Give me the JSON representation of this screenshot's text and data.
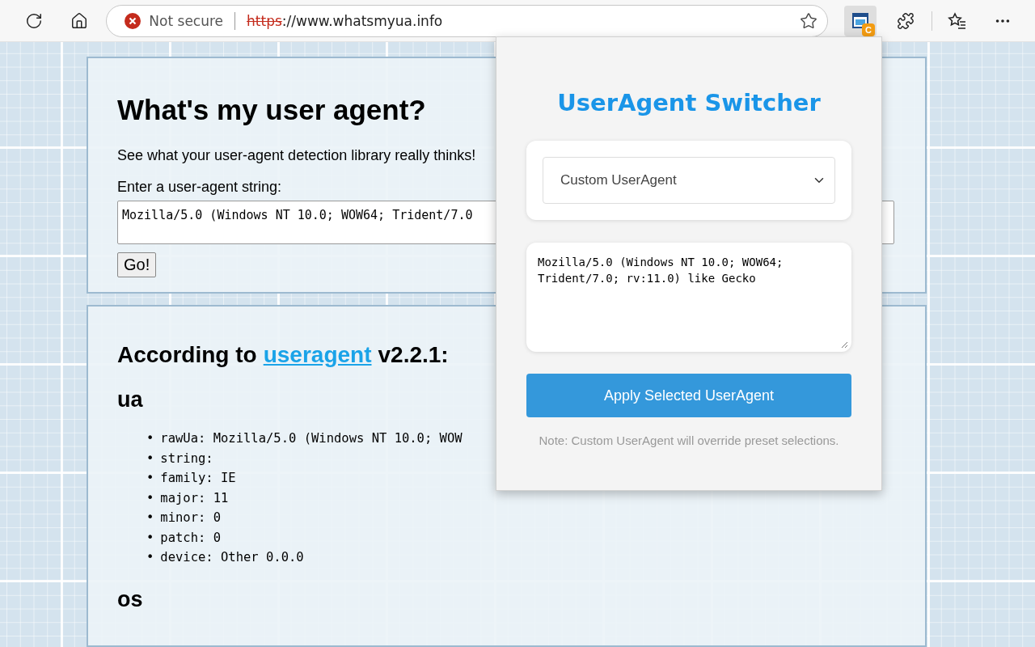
{
  "browser": {
    "security_label": "Not secure",
    "url_scheme": "https",
    "url_rest": "://www.whatsmyua.info",
    "extension_badge": "C"
  },
  "page": {
    "title": "What's my user agent?",
    "subtitle": "See what your user-agent detection library really thinks!",
    "input_label": "Enter a user-agent string:",
    "input_value": "Mozilla/5.0 (Windows NT 10.0; WOW64; Trident/7.0",
    "go_button": "Go!",
    "results_heading": {
      "prefix": "According to",
      "link": "useragent",
      "suffix": "v2.2.1:"
    },
    "sections": [
      {
        "title": "ua",
        "bullet": "•",
        "items": [
          "rawUa: Mozilla/5.0 (Windows NT 10.0; WOW",
          "string:",
          "family: IE",
          "major: 11",
          "minor: 0",
          "patch: 0",
          "device: Other 0.0.0"
        ]
      },
      {
        "title": "os"
      }
    ]
  },
  "popup": {
    "title": "UserAgent Switcher",
    "select_value": "Custom UserAgent",
    "custom_value": "Mozilla/5.0 (Windows NT 10.0; WOW64; Trident/7.0; rv:11.0) like Gecko",
    "apply_button": "Apply Selected UserAgent",
    "note": "Note: Custom UserAgent will override preset selections."
  }
}
